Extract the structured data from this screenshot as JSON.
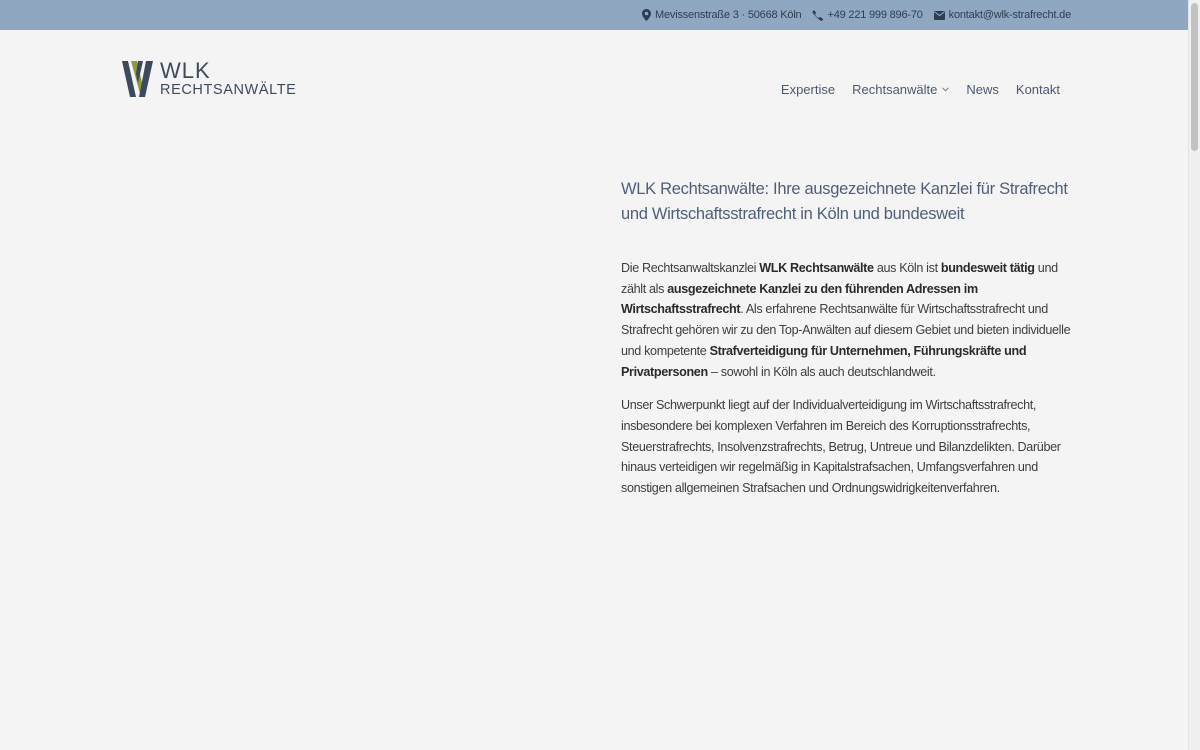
{
  "topbar": {
    "address": "Mevissenstraße 3 · 50668 Köln",
    "phone": "+49 221 999 896-70",
    "email": "kontakt@wlk-strafrecht.de",
    "bg_color": "#8fa7c0"
  },
  "logo": {
    "name": "WLK",
    "subtitle": "RECHTSANWÄLTE",
    "colors": [
      "#3d4a5e",
      "#8c9a3c"
    ]
  },
  "nav": {
    "items": [
      {
        "label": "Expertise"
      },
      {
        "label": "Rechtsanwälte",
        "icon": "chevron-down-icon"
      },
      {
        "label": "News"
      },
      {
        "label": "Kontakt"
      }
    ]
  },
  "main": {
    "heading": "WLK Rechtsanwälte: Ihre ausgezeichnete Kanzlei für Strafrecht und Wirtschaftsstrafrecht in Köln und bundesweit",
    "p1": {
      "s1": "Die Rechtsanwaltskanzlei ",
      "b1": "WLK Rechtsanwälte",
      "s2": " aus Köln ist ",
      "b2": "bundesweit tätig",
      "s3": " und zählt als ",
      "b3": "ausgezeichnete Kanzlei zu den führenden Adressen im Wirtschaftsstrafrecht",
      "s4": ". Als erfahrene Rechtsanwälte für Wirtschaftsstrafrecht und Strafrecht gehören wir zu den Top-Anwälten auf diesem Gebiet und bieten individuelle und kompetente ",
      "b4": "Strafverteidigung für Unternehmen, Führungskräfte und Privatpersonen",
      "s5": " – sowohl in Köln als auch deutschlandweit."
    },
    "p2": "Unser Schwerpunkt liegt auf der Individualverteidigung im Wirtschaftsstrafrecht, insbesondere bei komplexen Verfahren im Bereich des Korruptionsstrafrechts, Steuerstrafrechts, Insolvenzstrafrechts, Betrug, Untreue und Bilanzdelikten. Darüber hinaus verteidigen wir regelmäßig in Kapitalstrafsachen, Umfangsverfahren und sonstigen allgemeinen Strafsachen und Ordnungswidrigkeitenverfahren."
  }
}
